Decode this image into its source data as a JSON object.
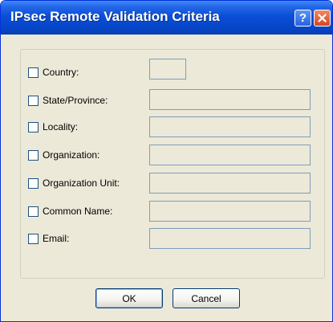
{
  "window": {
    "title": "IPsec Remote Validation Criteria",
    "help_label": "?",
    "close_icon": "close-icon"
  },
  "fields": [
    {
      "label": "Country:",
      "checked": false,
      "value": ""
    },
    {
      "label": "State/Province:",
      "checked": false,
      "value": ""
    },
    {
      "label": "Locality:",
      "checked": false,
      "value": ""
    },
    {
      "label": "Organization:",
      "checked": false,
      "value": ""
    },
    {
      "label": "Organization Unit:",
      "checked": false,
      "value": ""
    },
    {
      "label": "Common Name:",
      "checked": false,
      "value": ""
    },
    {
      "label": "Email:",
      "checked": false,
      "value": ""
    }
  ],
  "buttons": {
    "ok": "OK",
    "cancel": "Cancel"
  },
  "colors": {
    "titlebar": "#0a4fd8",
    "dialog_bg": "#ece9d8",
    "close_button": "#d44620"
  }
}
